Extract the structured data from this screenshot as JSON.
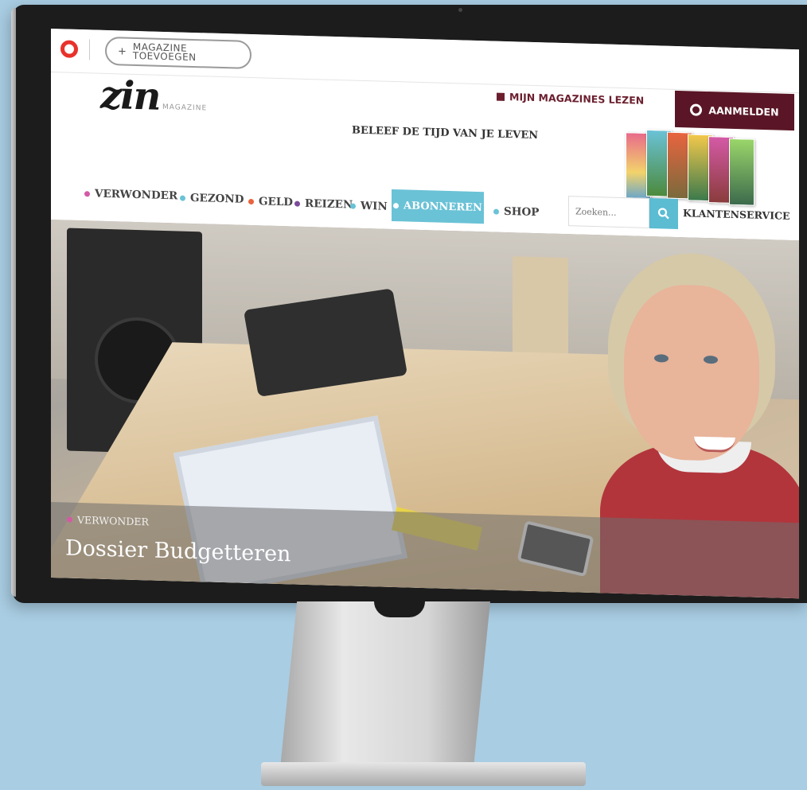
{
  "topbar": {
    "add_magazine_plus": "+",
    "add_magazine_line1": "MAGAZINE",
    "add_magazine_line2": "TOEVOEGEN"
  },
  "header": {
    "my_magazines": "MIJN MAGAZINES LEZEN",
    "login": "AANMELDEN",
    "logo": "zin",
    "logo_sub": "MAGAZINE",
    "tagline": "BELEEF DE TIJD VAN JE LEVEN"
  },
  "nav": {
    "items": [
      {
        "label": "VERWONDER",
        "color": "#d45aa6"
      },
      {
        "label": "GEZOND",
        "color": "#6ac2d6"
      },
      {
        "label": "GELD",
        "color": "#e8643e"
      },
      {
        "label": "REIZEN",
        "color": "#7a4b9a"
      },
      {
        "label": "WIN",
        "color": "#6ac2d6"
      },
      {
        "label": "ABONNEREN",
        "color": "#ffffff"
      },
      {
        "label": "SHOP",
        "color": "#6ac2d6"
      }
    ],
    "search_placeholder": "Zoeken...",
    "customer_service": "KLANTENSERVICE"
  },
  "hero": {
    "category": "VERWONDER",
    "category_color": "#d45aa6",
    "title": "Dossier Budgetteren"
  },
  "colors": {
    "brand": "#e8322b",
    "burgundy": "#5a1626",
    "accent": "#6ac2d6"
  }
}
